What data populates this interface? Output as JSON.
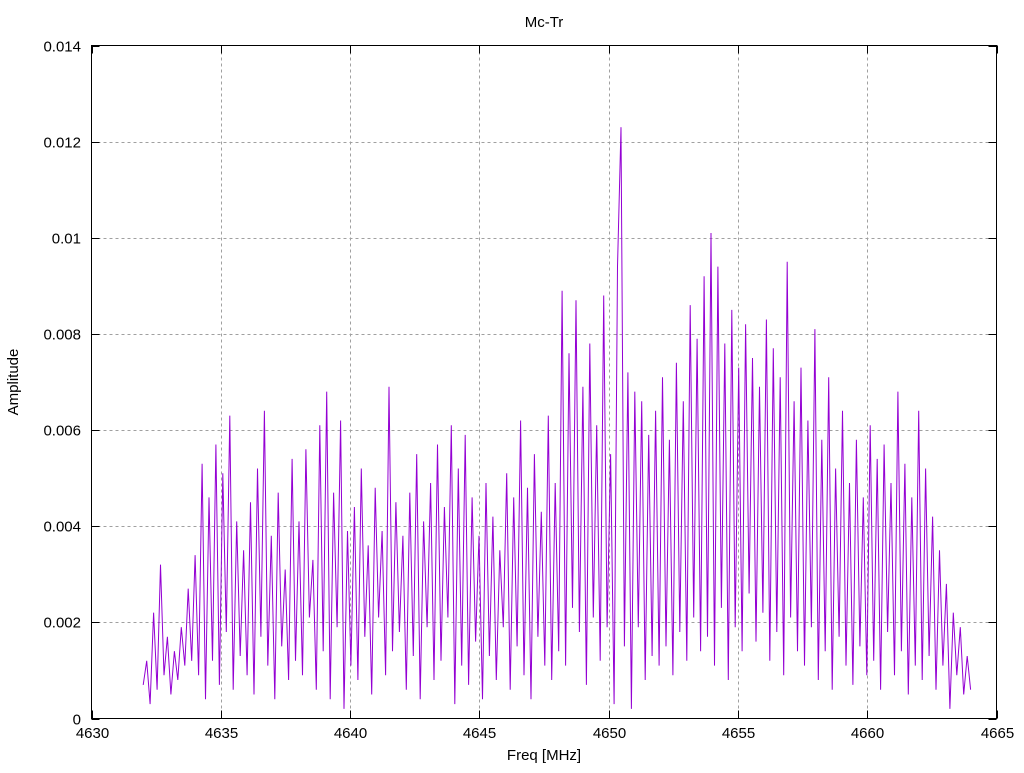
{
  "chart_data": {
    "type": "line",
    "title": "Mc-Tr",
    "xlabel": "Freq [MHz]",
    "ylabel": "Amplitude",
    "xlim": [
      4630,
      4665
    ],
    "ylim": [
      0,
      0.014
    ],
    "xticks": [
      4630,
      4635,
      4640,
      4645,
      4650,
      4655,
      4660,
      4665
    ],
    "xtick_labels": [
      "4630",
      "4635",
      "4640",
      "4645",
      "4650",
      "4655",
      "4660",
      "4665"
    ],
    "yticks": [
      0,
      0.002,
      0.004,
      0.006,
      0.008,
      0.01,
      0.012,
      0.014
    ],
    "ytick_labels": [
      "0",
      "0.002",
      "0.004",
      "0.006",
      "0.008",
      "0.01",
      "0.012",
      "0.014"
    ],
    "grid": true,
    "legend": "none",
    "series": [
      {
        "name": "Mc-Tr",
        "color": "#9400d3",
        "x_start": 4632,
        "x_end": 4664,
        "values": [
          0.0007,
          0.0012,
          0.0003,
          0.0022,
          0.0006,
          0.0032,
          0.0009,
          0.0017,
          0.0005,
          0.0014,
          0.0008,
          0.0019,
          0.0011,
          0.0027,
          0.0012,
          0.0034,
          0.0009,
          0.0053,
          0.0004,
          0.0046,
          0.0012,
          0.0057,
          0.0007,
          0.0051,
          0.0018,
          0.0063,
          0.0006,
          0.0041,
          0.0013,
          0.0035,
          0.0009,
          0.0045,
          0.0005,
          0.0052,
          0.0017,
          0.0064,
          0.0011,
          0.0038,
          0.0004,
          0.0047,
          0.0015,
          0.0031,
          0.0008,
          0.0054,
          0.0012,
          0.0041,
          0.0009,
          0.0056,
          0.0021,
          0.0033,
          0.0006,
          0.0061,
          0.0014,
          0.0068,
          0.0004,
          0.0047,
          0.0019,
          0.0062,
          0.0002,
          0.0039,
          0.0011,
          0.0044,
          0.0008,
          0.0052,
          0.0017,
          0.0036,
          0.0005,
          0.0048,
          0.0021,
          0.0039,
          0.0009,
          0.0069,
          0.0014,
          0.0045,
          0.0018,
          0.0038,
          0.0006,
          0.0047,
          0.0013,
          0.0055,
          0.0004,
          0.0041,
          0.0019,
          0.0049,
          0.0008,
          0.0057,
          0.0012,
          0.0044,
          0.0021,
          0.0061,
          0.0003,
          0.0052,
          0.0011,
          0.0059,
          0.0007,
          0.0046,
          0.0016,
          0.0038,
          0.0004,
          0.0049,
          0.0013,
          0.0042,
          0.0008,
          0.0035,
          0.0019,
          0.0051,
          0.0006,
          0.0046,
          0.0015,
          0.0062,
          0.0009,
          0.0048,
          0.0004,
          0.0055,
          0.0017,
          0.0043,
          0.0011,
          0.0063,
          0.0008,
          0.0049,
          0.0014,
          0.0089,
          0.0011,
          0.0076,
          0.0023,
          0.0087,
          0.0018,
          0.0069,
          0.0007,
          0.0078,
          0.0021,
          0.0061,
          0.0012,
          0.0088,
          0.0019,
          0.0055,
          0.0003,
          0.0094,
          0.0123,
          0.0015,
          0.0072,
          0.0002,
          0.0068,
          0.0019,
          0.0066,
          0.0008,
          0.0059,
          0.0013,
          0.0064,
          0.0011,
          0.0071,
          0.0015,
          0.0058,
          0.0009,
          0.0074,
          0.0018,
          0.0066,
          0.0012,
          0.0086,
          0.0021,
          0.0079,
          0.0014,
          0.0092,
          0.0017,
          0.0101,
          0.0011,
          0.0094,
          0.0023,
          0.0078,
          0.0008,
          0.0085,
          0.0019,
          0.0073,
          0.0014,
          0.0082,
          0.0026,
          0.0075,
          0.0016,
          0.0069,
          0.0022,
          0.0083,
          0.0012,
          0.0077,
          0.0018,
          0.0071,
          0.0009,
          0.0095,
          0.0021,
          0.0066,
          0.0014,
          0.0073,
          0.0011,
          0.0062,
          0.0019,
          0.0081,
          0.0008,
          0.0058,
          0.0014,
          0.0071,
          0.0006,
          0.0052,
          0.0017,
          0.0064,
          0.0011,
          0.0049,
          0.0007,
          0.0058,
          0.0015,
          0.0046,
          0.0009,
          0.0061,
          0.0012,
          0.0054,
          0.0006,
          0.0057,
          0.0018,
          0.0049,
          0.0009,
          0.0068,
          0.0014,
          0.0053,
          0.0005,
          0.0046,
          0.0011,
          0.0064,
          0.0008,
          0.0052,
          0.0013,
          0.0042,
          0.0006,
          0.0035,
          0.0011,
          0.0028,
          0.0002,
          0.0022,
          0.0009,
          0.0019,
          0.0005,
          0.0013,
          0.0006
        ]
      }
    ]
  }
}
